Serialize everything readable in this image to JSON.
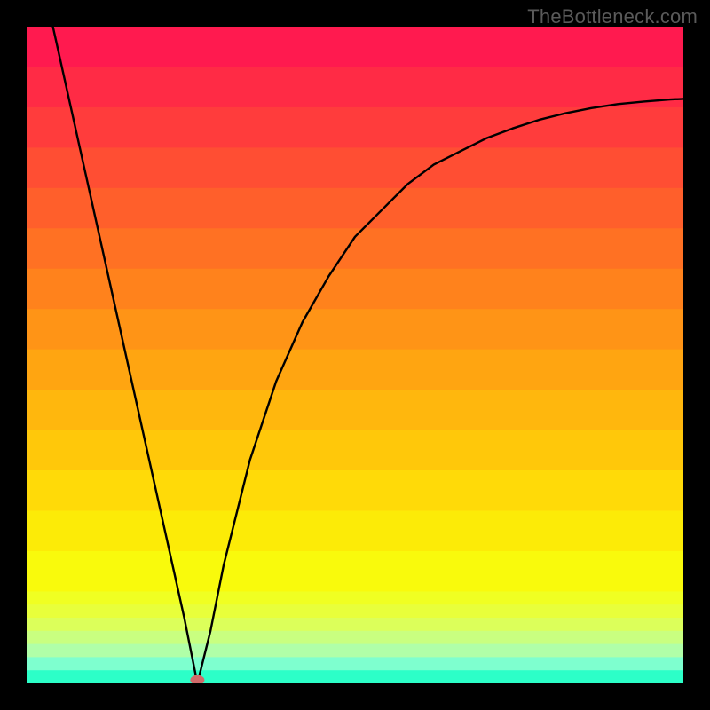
{
  "watermark": "TheBottleneck.com",
  "chart_data": {
    "type": "line",
    "title": "",
    "xlabel": "",
    "ylabel": "",
    "xlim": [
      0,
      100
    ],
    "ylim": [
      0,
      100
    ],
    "grid": false,
    "legend": false,
    "background": {
      "top_color": "#ff1a4f",
      "band_colors_top_to_bottom": [
        "#ff1a4f",
        "#ff2b45",
        "#ff3c3c",
        "#ff4e33",
        "#ff5f2b",
        "#ff7123",
        "#ff821c",
        "#ff9416",
        "#ffa511",
        "#ffb70d",
        "#ffc80a",
        "#ffda08",
        "#fceb07",
        "#f9fa0c",
        "#f0ff22",
        "#e8ff3b",
        "#dcff5a",
        "#c9ff80",
        "#b0ffa8",
        "#7effcf",
        "#2cffc8"
      ]
    },
    "marker": {
      "x": 26,
      "y": 0.5,
      "color": "#d06a6a",
      "shape": "ellipse"
    },
    "series": [
      {
        "name": "curve",
        "color": "#000000",
        "x": [
          4,
          8,
          12,
          16,
          20,
          24,
          26,
          28,
          30,
          34,
          38,
          42,
          46,
          50,
          54,
          58,
          62,
          66,
          70,
          74,
          78,
          82,
          86,
          90,
          94,
          98,
          100
        ],
        "values": [
          100,
          82,
          64,
          46,
          28,
          10,
          0,
          8,
          18,
          34,
          46,
          55,
          62,
          68,
          72,
          76,
          79,
          81,
          83,
          84.5,
          85.8,
          86.8,
          87.6,
          88.2,
          88.6,
          88.9,
          89
        ]
      }
    ]
  }
}
